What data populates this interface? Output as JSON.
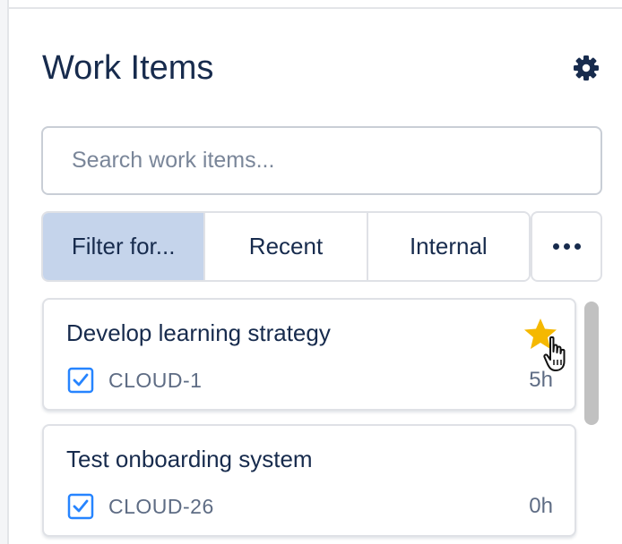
{
  "header": {
    "title": "Work Items",
    "settings_icon": "gear-icon"
  },
  "search": {
    "placeholder": "Search work items..."
  },
  "filters": {
    "tabs": [
      {
        "label": "Filter for...",
        "active": true
      },
      {
        "label": "Recent",
        "active": false
      },
      {
        "label": "Internal",
        "active": false
      }
    ],
    "more_icon": "more-horizontal-icon"
  },
  "work_items": [
    {
      "title": "Develop learning strategy",
      "key": "CLOUD-1",
      "estimate": "5h",
      "type_icon": "checkbox-icon",
      "starred": true
    },
    {
      "title": "Test onboarding system",
      "key": "CLOUD-26",
      "estimate": "0h",
      "type_icon": "checkbox-icon",
      "starred": false
    }
  ],
  "colors": {
    "text_primary": "#172b4d",
    "text_secondary": "#5e6c84",
    "active_tab_bg": "#c5d4eb",
    "checkbox_blue": "#2684ff",
    "star_gold": "#f5b800"
  }
}
